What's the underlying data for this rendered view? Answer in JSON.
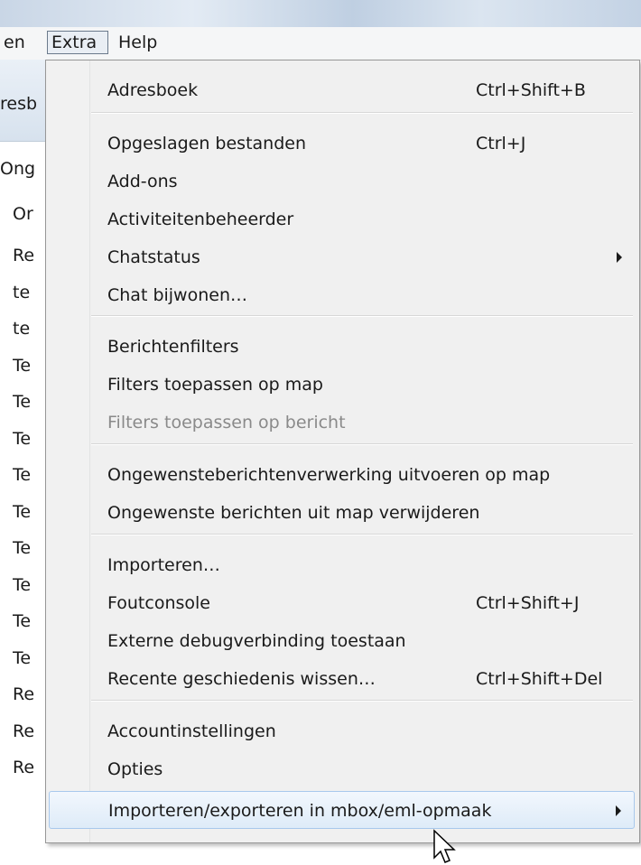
{
  "menubar": {
    "items": [
      {
        "label": "en"
      },
      {
        "label": "Extra"
      },
      {
        "label": "Help"
      }
    ]
  },
  "background": {
    "header_fragment": "resb",
    "tab_fragment": "Ong",
    "column_fragment": "Or",
    "rows": [
      "Re",
      "te",
      "te",
      "Te",
      "Te",
      "Te",
      "Te",
      "Te",
      "Te",
      "Te",
      "Te",
      "Te",
      "Re",
      "Re",
      "Re"
    ]
  },
  "menu": {
    "items": [
      {
        "label": "Adresboek",
        "shortcut": "Ctrl+Shift+B"
      },
      {
        "label": "Opgeslagen bestanden",
        "shortcut": "Ctrl+J"
      },
      {
        "label": "Add-ons",
        "shortcut": ""
      },
      {
        "label": "Activiteitenbeheerder",
        "shortcut": ""
      },
      {
        "label": "Chatstatus",
        "shortcut": "",
        "submenu": true
      },
      {
        "label": "Chat bijwonen…",
        "shortcut": ""
      },
      {
        "label": "Berichtenfilters",
        "shortcut": ""
      },
      {
        "label": "Filters toepassen op map",
        "shortcut": ""
      },
      {
        "label": "Filters toepassen op bericht",
        "shortcut": "",
        "disabled": true
      },
      {
        "label": "Ongewensteberichtenverwerking uitvoeren op map",
        "shortcut": ""
      },
      {
        "label": "Ongewenste berichten uit map verwijderen",
        "shortcut": ""
      },
      {
        "label": "Importeren…",
        "shortcut": ""
      },
      {
        "label": "Foutconsole",
        "shortcut": "Ctrl+Shift+J"
      },
      {
        "label": "Externe debugverbinding toestaan",
        "shortcut": ""
      },
      {
        "label": "Recente geschiedenis wissen…",
        "shortcut": "Ctrl+Shift+Del"
      },
      {
        "label": "Accountinstellingen",
        "shortcut": ""
      },
      {
        "label": "Opties",
        "shortcut": ""
      },
      {
        "label": "Importeren/exporteren in mbox/eml-opmaak",
        "shortcut": "",
        "submenu": true,
        "highlighted": true
      }
    ]
  },
  "colors": {
    "menu_bg": "#f0f0f0",
    "highlight_border": "#a8c8ec",
    "disabled_text": "#8a8a8a"
  }
}
